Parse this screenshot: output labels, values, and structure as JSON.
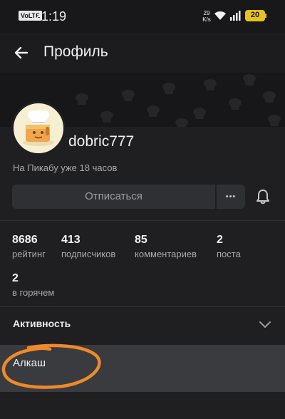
{
  "status_bar": {
    "network_badge": "VoLTE",
    "time": "21:19",
    "net_speed_value": "29",
    "net_speed_unit": "K/s",
    "battery": "20"
  },
  "app_bar": {
    "title": "Профиль"
  },
  "profile": {
    "username": "dobric777",
    "since": "На Пикабу уже 18 часов",
    "unsubscribe_label": "Отписаться",
    "more_label": "•••"
  },
  "stats": [
    {
      "value": "8686",
      "label": "рейтинг"
    },
    {
      "value": "413",
      "label": "подписчиков"
    },
    {
      "value": "85",
      "label": "комментариев"
    },
    {
      "value": "2",
      "label": "поста"
    },
    {
      "value": "2",
      "label": "в горячем"
    }
  ],
  "activity": {
    "title": "Активность",
    "items": [
      {
        "label": "Алкаш"
      }
    ]
  },
  "colors": {
    "background": "#1f1f22",
    "button": "#2f3033",
    "highlight_item": "#3a3b3e",
    "annotation": "#ee8a2c",
    "battery": "#e6c21e"
  }
}
